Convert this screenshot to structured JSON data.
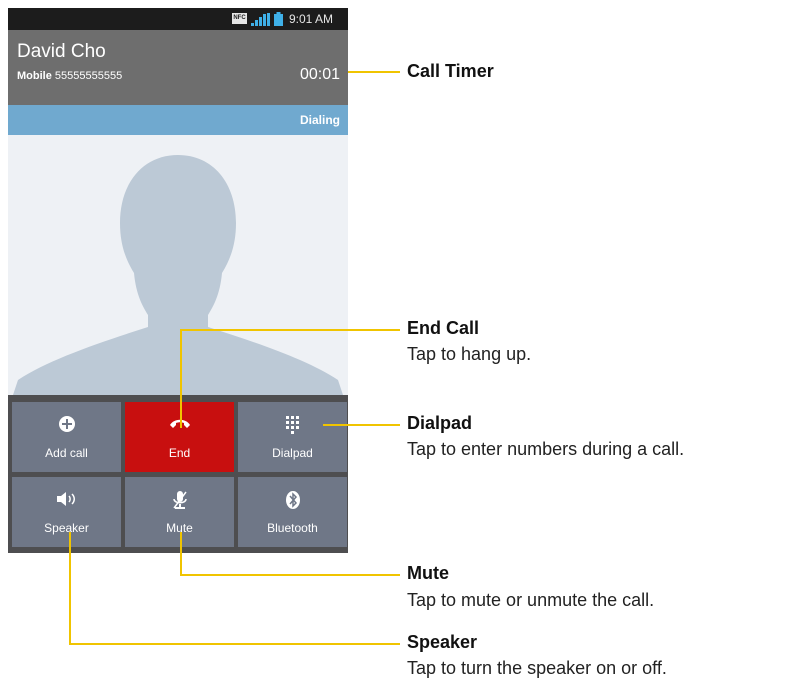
{
  "status_bar": {
    "nfc_label": "NFC",
    "time": "9:01 AM"
  },
  "call": {
    "contact_name": "David Cho",
    "number_type": "Mobile",
    "number": "55555555555",
    "timer": "00:01",
    "status": "Dialing"
  },
  "buttons": [
    {
      "label": "Add call",
      "icon": "add-icon"
    },
    {
      "label": "End",
      "icon": "end-call-icon"
    },
    {
      "label": "Dialpad",
      "icon": "dialpad-icon"
    },
    {
      "label": "Speaker",
      "icon": "speaker-icon"
    },
    {
      "label": "Mute",
      "icon": "mute-mic-icon"
    },
    {
      "label": "Bluetooth",
      "icon": "bluetooth-icon"
    }
  ],
  "annotations": {
    "call_timer": {
      "title": "Call Timer"
    },
    "end_call": {
      "title": "End Call",
      "desc": "Tap to hang up."
    },
    "dialpad": {
      "title": "Dialpad",
      "desc": "Tap to enter numbers during a call."
    },
    "mute": {
      "title": "Mute",
      "desc": "Tap to mute or unmute the call."
    },
    "speaker": {
      "title": "Speaker",
      "desc": "Tap to turn the speaker on or off."
    }
  },
  "colors": {
    "end_button": "#c80f0f",
    "button_bg": "#6f7787",
    "status_bar_blue": "#70a9cf",
    "callout": "#f0c400"
  }
}
